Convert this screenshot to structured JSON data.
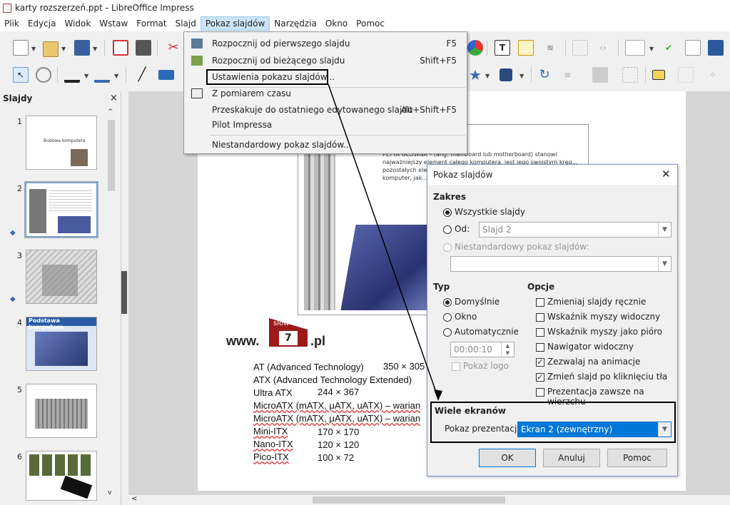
{
  "window": {
    "title": "karty rozszerzeń.ppt - LibreOffice Impress"
  },
  "menubar": {
    "items": [
      "Plik",
      "Edycja",
      "Widok",
      "Wstaw",
      "Format",
      "Slajd",
      "Pokaz slajdów",
      "Narzędzia",
      "Okno",
      "Pomoc"
    ]
  },
  "dropdown": {
    "items": [
      {
        "label": "Rozpocznij od pierwszego slajdu",
        "accel": "F5"
      },
      {
        "label": "Rozpocznij od bieżącego slajdu",
        "accel": "Shift+F5"
      },
      {
        "label": "Ustawienia pokazu slajdów...",
        "accel": ""
      },
      {
        "label": "Z pomiarem czasu",
        "accel": ""
      },
      {
        "label": "Przeskakuje do ostatniego edytowanego slajdu",
        "accel": "Alt+Shift+F5"
      },
      {
        "label": "Pilot Impressa",
        "accel": ""
      },
      {
        "label": "Niestandardowy pokaz slajdów...",
        "accel": ""
      }
    ]
  },
  "slides_panel": {
    "title": "Slajdy",
    "close": "×",
    "numbers": [
      "1",
      "2",
      "3",
      "4",
      "5",
      "6"
    ],
    "thumb1_text": "Budowa komputera",
    "thumb4_text": "Podstawa komputera"
  },
  "slide": {
    "watermark_www": "www.",
    "watermark_slow": "slow",
    "watermark_7": "7",
    "watermark_pl": ".pl",
    "paragraph": "PŁYTA GŁÓWNA – (ang. mainboard lub motherboard) stanowi najważniejszy element całego komputera, jest jego swoistym kręg... pozostałych ele... odbywa się wz... zainstalowany... zależy jakimi r... komputer, jak... decyduje o w... współpracowac... przerzający...",
    "specs": [
      {
        "name": "AT (Advanced Technology)",
        "value": "350 × 305"
      },
      {
        "name": "ATX (Advanced Technology Extended)",
        "value": ""
      },
      {
        "name": "Ultra ATX",
        "value": "244 × 367"
      },
      {
        "name": "MicroATX (mATX, μATX, uATX) – warian",
        "value": ""
      },
      {
        "name": "MicroATX (mATX, μATX, uATX) – warian",
        "value": ""
      },
      {
        "name": "Mini-ITX",
        "value": "170 × 170"
      },
      {
        "name": "Nano-ITX",
        "value": "120 × 120"
      },
      {
        "name": "Pico-ITX",
        "value": "100 × 72"
      }
    ]
  },
  "dialog": {
    "title": "Pokaz slajdów",
    "close": "✕",
    "range_title": "Zakres",
    "all_slides": "Wszystkie slajdy",
    "from": "Od:",
    "from_value": "Slajd 2",
    "custom": "Niestandardowy pokaz slajdów:",
    "type_title": "Typ",
    "type_default": "Domyślnie",
    "type_window": "Okno",
    "type_auto": "Automatycznie",
    "time_value": "00:00:10",
    "show_logo": "Pokaż logo",
    "options_title": "Opcje",
    "options": [
      {
        "label": "Zmieniaj slajdy ręcznie",
        "checked": false
      },
      {
        "label": "Wskaźnik myszy widoczny",
        "checked": false
      },
      {
        "label": "Wskaźnik myszy jako pióro",
        "checked": false
      },
      {
        "label": "Nawigator widoczny",
        "checked": false
      },
      {
        "label": "Zezwalaj na animacje",
        "checked": true
      },
      {
        "label": "Zmień slajd po kliknięciu tła",
        "checked": true
      },
      {
        "label": "Prezentacja zawsze na wierzchu",
        "checked": false
      }
    ],
    "multi_title": "Wiele ekranów",
    "presentation_display_label": "Pokaz prezentacji:",
    "presentation_display_value": "Ekran 2 (zewnętrzny)",
    "ok": "OK",
    "cancel": "Anuluj",
    "help": "Pomoc"
  },
  "colors": {
    "selection": "#0078d7",
    "menu_highlight": "#cce4f7"
  }
}
